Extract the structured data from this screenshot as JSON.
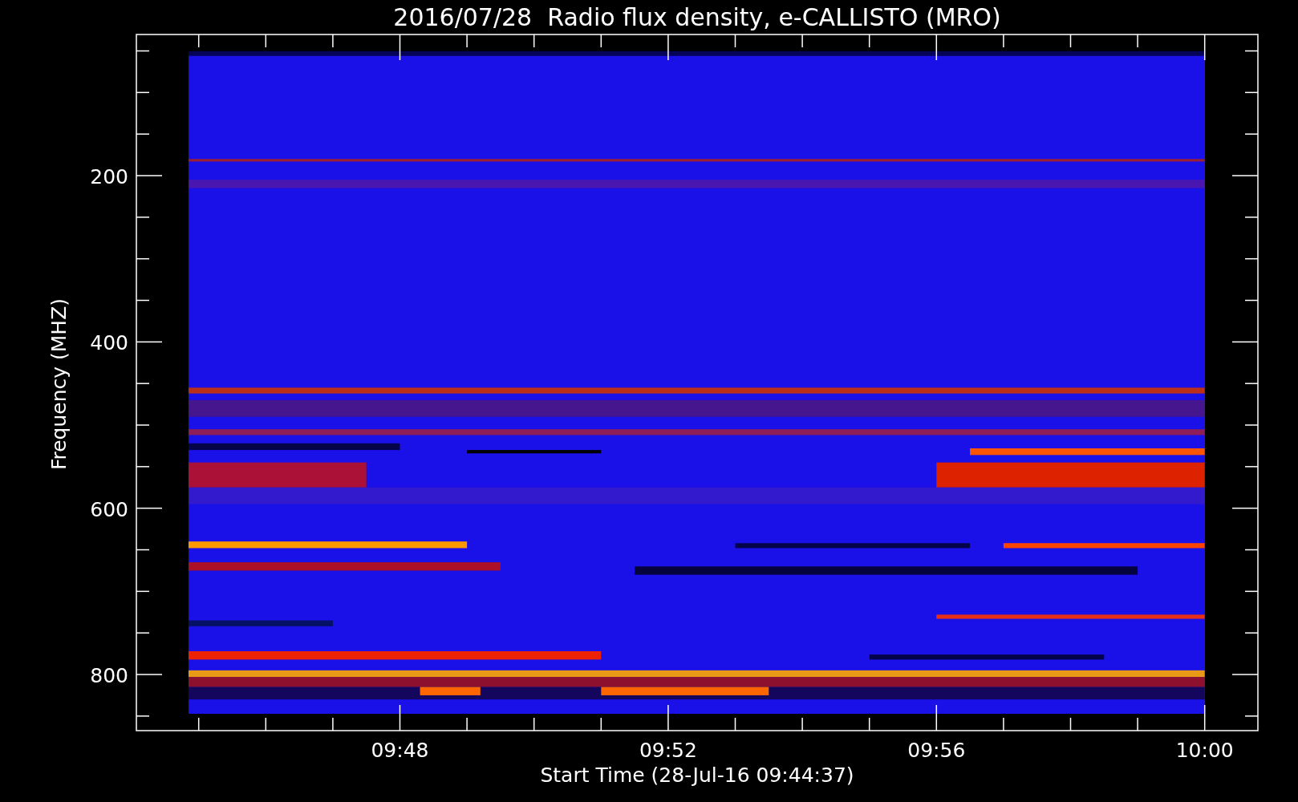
{
  "title": "2016/07/28  Radio flux density, e-CALLISTO (MRO)",
  "y_axis": {
    "label": "Frequency (MHZ)",
    "ticks": [
      "200",
      "400",
      "600",
      "800"
    ]
  },
  "x_axis": {
    "label": "Start Time (28-Jul-16 09:44:37)",
    "ticks": [
      "09:48",
      "09:52",
      "09:56",
      "10:00"
    ]
  }
}
